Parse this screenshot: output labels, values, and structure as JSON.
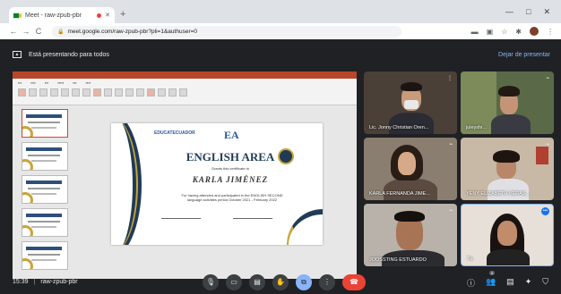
{
  "browser": {
    "tab_title": "Meet - raw-zpub-pbr",
    "tab_close": "✕",
    "new_tab": "+",
    "window_controls": [
      "—",
      "□",
      "✕"
    ],
    "nav": {
      "back": "←",
      "forward": "→",
      "reload": "C"
    },
    "url": "meet.google.com/raw-zpub-pbr?pli=1&authuser=0"
  },
  "meet": {
    "presenting_text": "Está presentando para todos",
    "stop_presenting": "Dejar de presentar",
    "slide": {
      "logo_left": "EDUCATECUADOR",
      "logo_right": "EA",
      "title": "ENGLISH AREA",
      "subtitle": "Grants this certificate to",
      "name": "KARLA JIMÉNEZ",
      "body": "For having attended and participated in the ENGLISH SECOND language activities period October 2021 - February 2022"
    },
    "participants": [
      {
        "name": "Lic. Jonny Christian Oren..."
      },
      {
        "name": "juleyshi..."
      },
      {
        "name": "KARLA FERNANDA JIME..."
      },
      {
        "name": "YENY ELIZABETH VERAS..."
      },
      {
        "name": "JOOSSTING ESTUARDO"
      },
      {
        "name": "Tú"
      }
    ],
    "bottom": {
      "time": "15:39",
      "separator": "|",
      "meeting_code": "raw-zpub-pbr",
      "participant_count": "8"
    }
  },
  "icons": {
    "mic": "🎙",
    "cam": "▭",
    "cc": "▤",
    "hand": "✋",
    "present": "⧉",
    "more": "⋮",
    "end": "☎",
    "info": "ⓘ",
    "people": "👥",
    "chat": "▤",
    "activities": "✦",
    "safety": "⛉"
  },
  "colors": {
    "meet_bg": "#202124",
    "accent": "#8ab4f8",
    "end_call": "#ea4335",
    "powerpoint": "#b7472a"
  }
}
